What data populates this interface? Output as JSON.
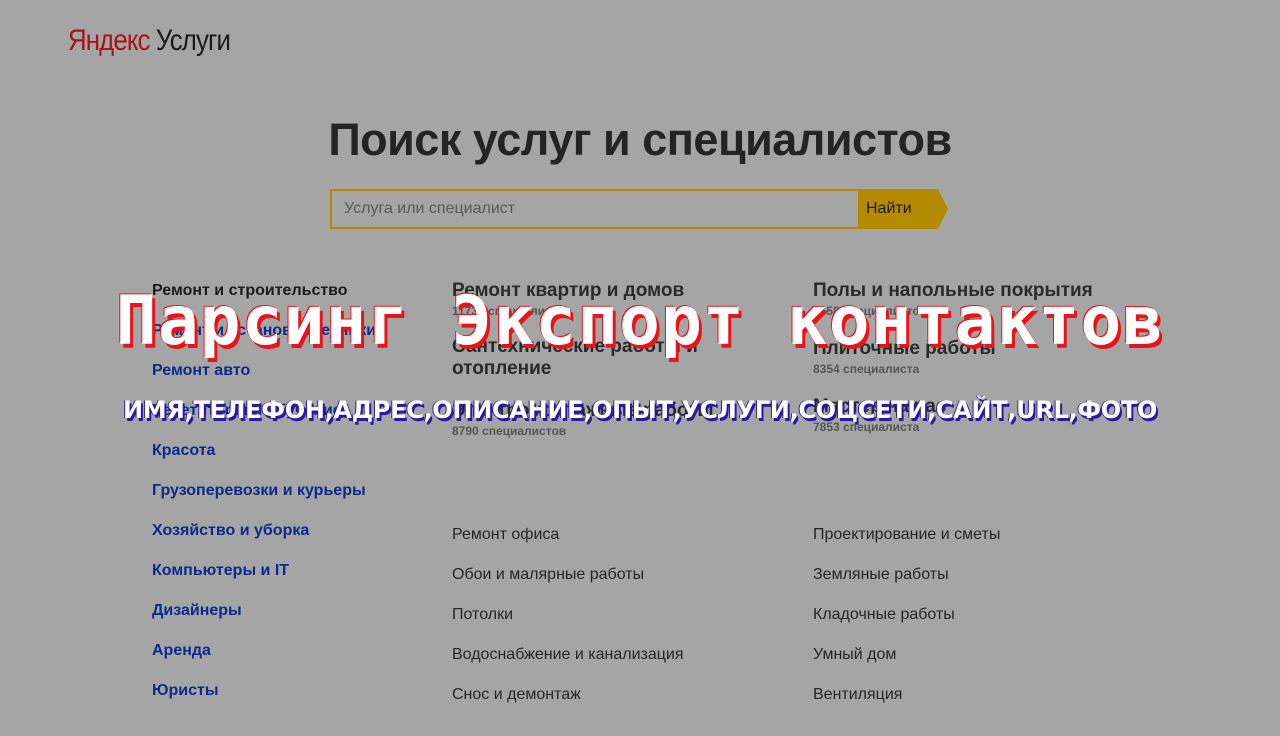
{
  "logo": {
    "yandex": "Яндекс",
    "services": "Услуги"
  },
  "page_title": "Поиск услуг и специалистов",
  "search": {
    "placeholder": "Услуга или специалист",
    "button": "Найти"
  },
  "categories": [
    "Ремонт и строительство",
    "Ремонт и установка техники",
    "Ремонт авто",
    "Репетиторы и обучение",
    "Красота",
    "Грузоперевозки и курьеры",
    "Хозяйство и уборка",
    "Компьютеры и IT",
    "Дизайнеры",
    "Аренда",
    "Юристы"
  ],
  "groups_mid": [
    {
      "title": "Ремонт квартир и домов",
      "count": "11736 специалистов"
    },
    {
      "title": "Сантехнические работы и отопление",
      "count": ""
    },
    {
      "title": "Электромонтажные работы",
      "count": "8790 специалистов"
    }
  ],
  "groups_right": [
    {
      "title": "Полы и напольные покрытия",
      "count": "8658 специалистов"
    },
    {
      "title": "Плиточные работы",
      "count": "8354 специалиста"
    },
    {
      "title": "Мастер на час",
      "count": "7853 специалиста"
    }
  ],
  "sub_mid": [
    "Ремонт офиса",
    "Обои и малярные работы",
    "Потолки",
    "Водоснабжение и канализация",
    "Снос и демонтаж"
  ],
  "sub_right": [
    "Проектирование и сметы",
    "Земляные работы",
    "Кладочные работы",
    "Умный дом",
    "Вентиляция"
  ],
  "overlay": {
    "headline": "Парсинг Экспорт контактов",
    "fields": "ИМЯ,ТЕЛЕФОН,АДРЕС,ОПИСАНИЕ,ОПЫТ,УСЛУГИ,СОЦСЕТИ,САЙТ,URL,ФОТО"
  },
  "colors": {
    "background": "#a5a5a5",
    "accent": "#b38a00",
    "link": "#0d2a8a",
    "overlay_red": "#e8141a",
    "overlay_blue": "#2a1aa0"
  }
}
